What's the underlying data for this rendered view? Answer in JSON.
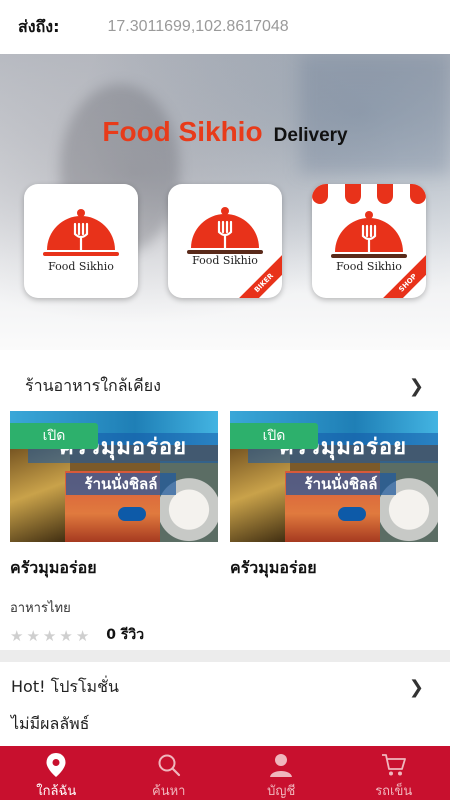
{
  "header": {
    "label": "ส่งถึง:",
    "coordinates": "17.3011699,102.8617048"
  },
  "hero": {
    "brand_main": "Food Sikhio",
    "brand_sub": "Delivery",
    "apps": [
      {
        "text": "Food Sikhio",
        "ribbon": ""
      },
      {
        "text": "Food Sikhio",
        "ribbon": "BIKER"
      },
      {
        "text": "Food Sikhio",
        "ribbon": "SHOP"
      }
    ],
    "colors": {
      "brand": "#e83b1a",
      "ribbon": "#e8321a"
    }
  },
  "nearby": {
    "title": "ร้านอาหารใกล้เคียง",
    "restaurants": [
      {
        "status": "เปิด",
        "banner_top": "ครัวมุมอร่อย",
        "banner_sub": "ร้านนั่งชิลล์",
        "name": "ครัวมุมอร่อย",
        "category": "อาหารไทย",
        "rating": 0,
        "reviews": "0 รีวิว"
      },
      {
        "status": "เปิด",
        "banner_top": "ครัวมุมอร่อย",
        "banner_sub": "ร้านนั่งชิลล์",
        "name": "ครัวมุมอร่อย"
      }
    ]
  },
  "promotions": {
    "title": "Hot! โปรโมชั่น",
    "empty_text": "ไม่มีผลลัพธ์"
  },
  "bottom_nav": {
    "items": [
      {
        "label": "ใกล้ฉัน",
        "icon": "location-pin-icon",
        "active": true
      },
      {
        "label": "ค้นหา",
        "icon": "search-icon",
        "active": false
      },
      {
        "label": "บัญชี",
        "icon": "user-icon",
        "active": false
      },
      {
        "label": "รถเข็น",
        "icon": "cart-icon",
        "active": false
      }
    ],
    "background": "#c8102e"
  }
}
